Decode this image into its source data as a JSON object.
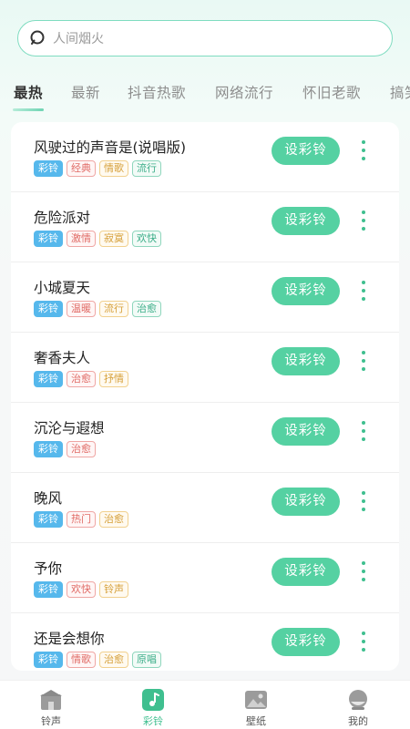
{
  "search": {
    "placeholder": "人间烟火",
    "icon": "search-icon"
  },
  "tabs": [
    {
      "label": "最热",
      "active": true
    },
    {
      "label": "最新",
      "active": false
    },
    {
      "label": "抖音热歌",
      "active": false
    },
    {
      "label": "网络流行",
      "active": false
    },
    {
      "label": "怀旧老歌",
      "active": false
    },
    {
      "label": "搞笑",
      "active": false
    }
  ],
  "set_button_label": "设彩铃",
  "songs": [
    {
      "title": "风驶过的声音是(说唱版)",
      "tags": [
        {
          "text": "彩铃",
          "style": "caling"
        },
        {
          "text": "经典",
          "style": "red"
        },
        {
          "text": "情歌",
          "style": "yellow"
        },
        {
          "text": "流行",
          "style": "green"
        }
      ]
    },
    {
      "title": "危险派对",
      "tags": [
        {
          "text": "彩铃",
          "style": "caling"
        },
        {
          "text": "激情",
          "style": "red"
        },
        {
          "text": "寂寞",
          "style": "yellow"
        },
        {
          "text": "欢快",
          "style": "green"
        }
      ]
    },
    {
      "title": "小城夏天",
      "tags": [
        {
          "text": "彩铃",
          "style": "caling"
        },
        {
          "text": "温暖",
          "style": "red"
        },
        {
          "text": "流行",
          "style": "yellow"
        },
        {
          "text": "治愈",
          "style": "green"
        }
      ]
    },
    {
      "title": "奢香夫人",
      "tags": [
        {
          "text": "彩铃",
          "style": "caling"
        },
        {
          "text": "治愈",
          "style": "red"
        },
        {
          "text": "抒情",
          "style": "yellow"
        }
      ]
    },
    {
      "title": "沉沦与遐想",
      "tags": [
        {
          "text": "彩铃",
          "style": "caling"
        },
        {
          "text": "治愈",
          "style": "red"
        }
      ]
    },
    {
      "title": "晚风",
      "tags": [
        {
          "text": "彩铃",
          "style": "caling"
        },
        {
          "text": "热门",
          "style": "red"
        },
        {
          "text": "治愈",
          "style": "yellow"
        }
      ]
    },
    {
      "title": "予你",
      "tags": [
        {
          "text": "彩铃",
          "style": "caling"
        },
        {
          "text": "欢快",
          "style": "red"
        },
        {
          "text": "铃声",
          "style": "yellow"
        }
      ]
    },
    {
      "title": "还是会想你",
      "tags": [
        {
          "text": "彩铃",
          "style": "caling"
        },
        {
          "text": "情歌",
          "style": "red"
        },
        {
          "text": "治愈",
          "style": "yellow"
        },
        {
          "text": "原唱",
          "style": "green"
        }
      ]
    }
  ],
  "bottom_nav": [
    {
      "label": "铃声",
      "icon": "house-icon",
      "active": false
    },
    {
      "label": "彩铃",
      "icon": "music-note-icon",
      "active": true
    },
    {
      "label": "壁纸",
      "icon": "image-icon",
      "active": false
    },
    {
      "label": "我的",
      "icon": "user-icon",
      "active": false
    }
  ],
  "colors": {
    "accent": "#55d1a2",
    "tag_caling": "#56b8ec",
    "tag_red": "#e06b66",
    "tag_yellow": "#d6a03a",
    "tag_green": "#3cae89"
  }
}
